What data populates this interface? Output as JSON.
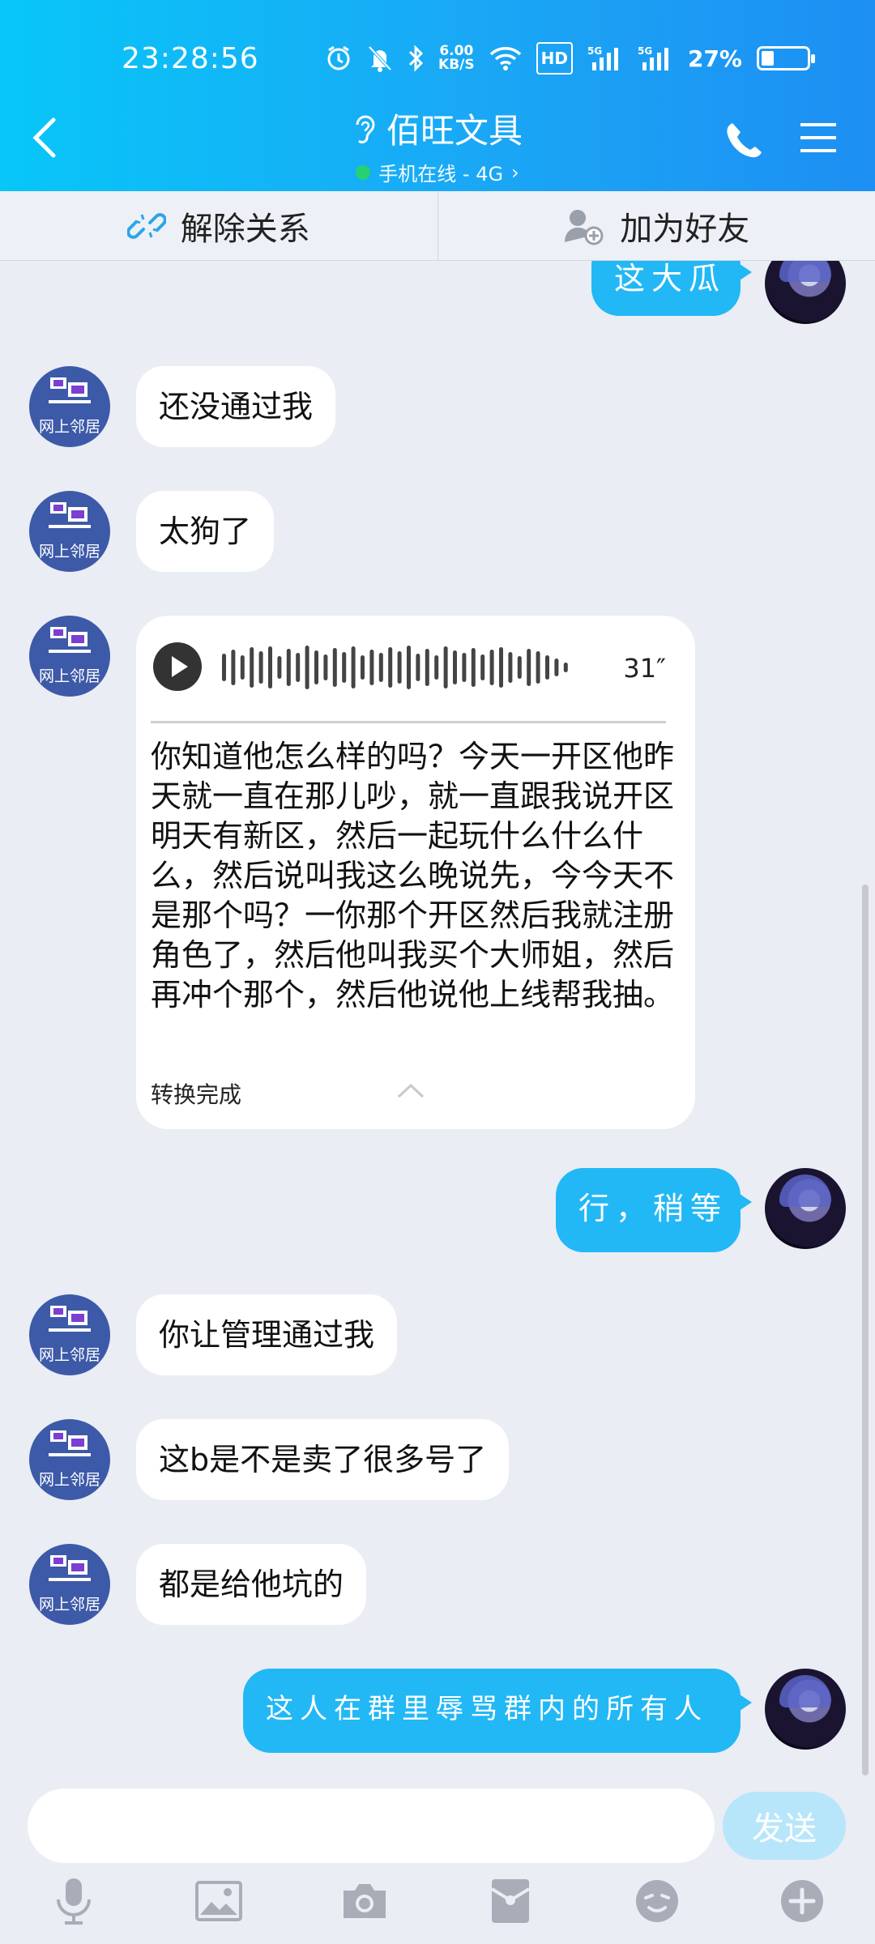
{
  "status_bar": {
    "time": "23:28:56",
    "speed_value": "6.00",
    "speed_unit": "KB/S",
    "hd_badge": "HD",
    "sim1": "5G",
    "sim2": "5G",
    "battery_percent": "27%",
    "battery_level": 0.27
  },
  "header": {
    "title": "佰旺文具",
    "subtitle": "手机在线 - 4G",
    "subtitle_arrow": "›"
  },
  "action_bar": {
    "unlink_label": "解除关系",
    "add_friend_label": "加为好友"
  },
  "incoming_avatar_text": "网上邻居",
  "messages": [
    {
      "id": "m0",
      "from": "me",
      "text": "这大瓜"
    },
    {
      "id": "m1",
      "from": "them",
      "text": "还没通过我"
    },
    {
      "id": "m2",
      "from": "them",
      "text": "太狗了"
    },
    {
      "id": "m3",
      "from": "them",
      "type": "voice",
      "duration": "31″",
      "transcript": "你知道他怎么样的吗？今天一开区他昨天就一直在那儿吵，就一直跟我说开区明天有新区，然后一起玩什么什么什么，然后说叫我这么晚说先，今今天不是那个吗？一你那个开区然后我就注册角色了，然后他叫我买个大师姐，然后再冲个那个，然后他说他上线帮我抽。",
      "status": "转换完成"
    },
    {
      "id": "m4",
      "from": "me",
      "text": "行，稍等"
    },
    {
      "id": "m5",
      "from": "them",
      "text": "你让管理通过我"
    },
    {
      "id": "m6",
      "from": "them",
      "text": "这b是不是卖了很多号了"
    },
    {
      "id": "m7",
      "from": "them",
      "text": "都是给他坑的"
    },
    {
      "id": "m8",
      "from": "me",
      "text": "这人在群里辱骂群内的所有人"
    }
  ],
  "input": {
    "value": "",
    "placeholder": "",
    "send_label": "发送"
  },
  "toolbar": [
    "mic-icon",
    "image-icon",
    "camera-icon",
    "red-packet-icon",
    "emoji-icon",
    "plus-icon"
  ],
  "colors": {
    "header_start": "#08c6f8",
    "header_end": "#1d8ff3",
    "outgoing_bubble": "#22b8f5",
    "send_button": "#b7e6fb",
    "online_dot": "#27d36a"
  }
}
